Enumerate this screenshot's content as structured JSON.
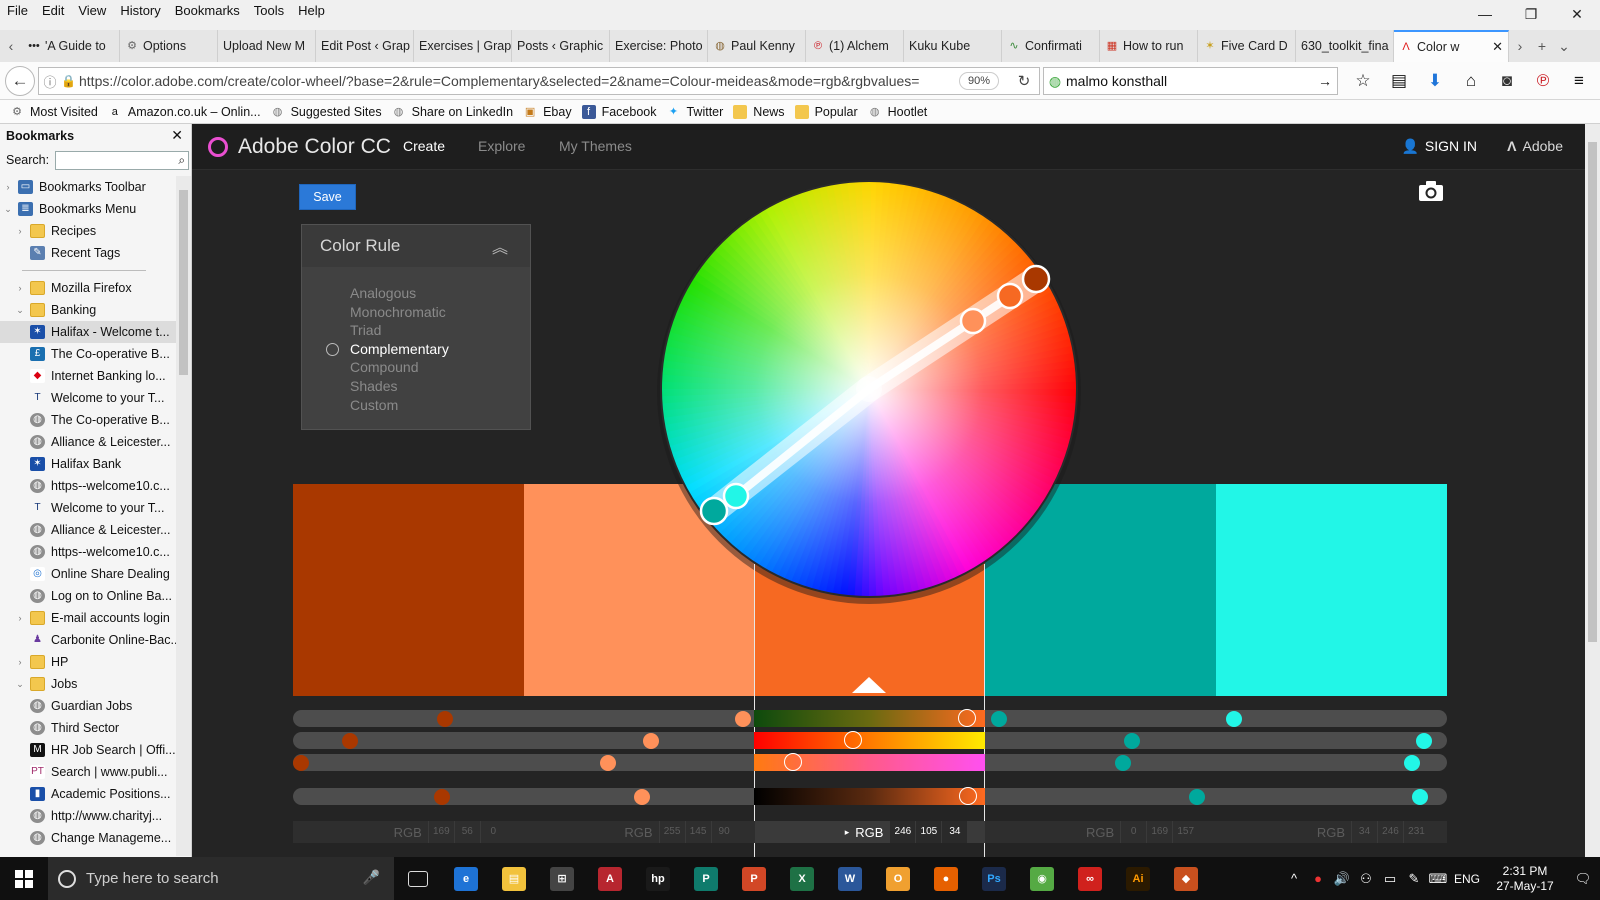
{
  "menubar": [
    "File",
    "Edit",
    "View",
    "History",
    "Bookmarks",
    "Tools",
    "Help"
  ],
  "tabs": [
    {
      "label": "'A Guide to",
      "icon": "dots-icon"
    },
    {
      "label": "Options",
      "icon": "gear-icon"
    },
    {
      "label": "Upload New M",
      "icon": "page-icon"
    },
    {
      "label": "Edit Post ‹ Grap",
      "icon": "page-icon"
    },
    {
      "label": "Exercises | Grap",
      "icon": "page-icon"
    },
    {
      "label": "Posts ‹ Graphic",
      "icon": "page-icon"
    },
    {
      "label": "Exercise: Photo",
      "icon": "page-icon"
    },
    {
      "label": "Paul Kenny",
      "icon": "avatar-icon"
    },
    {
      "label": "(1) Alchem",
      "icon": "pinterest-icon"
    },
    {
      "label": "Kuku Kube",
      "icon": "page-icon"
    },
    {
      "label": "Confirmati",
      "icon": "wave-icon"
    },
    {
      "label": "How to run",
      "icon": "grid-icon"
    },
    {
      "label": "Five Card D",
      "icon": "cards-icon"
    },
    {
      "label": "630_toolkit_fina",
      "icon": "page-icon"
    },
    {
      "label": "Color w",
      "icon": "adobe-icon",
      "active": true
    }
  ],
  "nav": {
    "url": "https://color.adobe.com/create/color-wheel/?base=2&rule=Complementary&selected=2&name=Colour-meideas&mode=rgb&rgbvalues=",
    "url_domain": "adobe.com",
    "zoom": "90%",
    "search_value": "malmo konsthall"
  },
  "bookmarks_toolbar": [
    {
      "label": "Most Visited",
      "icon": "gear-icon"
    },
    {
      "label": "Amazon.co.uk – Onlin...",
      "icon": "amazon-icon"
    },
    {
      "label": "Suggested Sites",
      "icon": "globe-icon"
    },
    {
      "label": "Share on LinkedIn",
      "icon": "globe-icon"
    },
    {
      "label": "Ebay",
      "icon": "bag-icon"
    },
    {
      "label": "Facebook",
      "icon": "facebook-icon"
    },
    {
      "label": "Twitter",
      "icon": "twitter-icon"
    },
    {
      "label": "News",
      "icon": "folder-icon"
    },
    {
      "label": "Popular",
      "icon": "folder-icon"
    },
    {
      "label": "Hootlet",
      "icon": "globe-icon"
    }
  ],
  "sidebar": {
    "title": "Bookmarks",
    "search_label": "Search:",
    "items": [
      {
        "label": "Bookmarks Toolbar",
        "level": 0,
        "twisty": "▷",
        "icon": "toolbar-icon"
      },
      {
        "label": "Bookmarks Menu",
        "level": 0,
        "twisty": "◢",
        "icon": "menu-icon"
      },
      {
        "label": "Recipes",
        "level": 1,
        "twisty": "▷",
        "icon": "folder-icon"
      },
      {
        "label": "Recent Tags",
        "level": 1,
        "twisty": "",
        "icon": "tag-icon"
      },
      {
        "sep": true
      },
      {
        "label": "Mozilla Firefox",
        "level": 1,
        "twisty": "▷",
        "icon": "folder-icon"
      },
      {
        "label": "Banking",
        "level": 1,
        "twisty": "◢",
        "icon": "folder-icon"
      },
      {
        "label": "Halifax - Welcome t...",
        "level": 2,
        "twisty": "",
        "icon": "halifax-icon",
        "selected": true
      },
      {
        "label": "The Co-operative B...",
        "level": 2,
        "twisty": "",
        "icon": "pound-icon"
      },
      {
        "label": "Internet Banking lo...",
        "level": 2,
        "twisty": "",
        "icon": "hsbc-icon"
      },
      {
        "label": "Welcome to your T...",
        "level": 2,
        "twisty": "",
        "icon": "t-icon"
      },
      {
        "label": "The Co-operative B...",
        "level": 2,
        "twisty": "",
        "icon": "globe-icon"
      },
      {
        "label": "Alliance & Leicester...",
        "level": 2,
        "twisty": "",
        "icon": "globe-icon"
      },
      {
        "label": "Halifax Bank",
        "level": 2,
        "twisty": "",
        "icon": "halifax-icon"
      },
      {
        "label": "https--welcome10.c...",
        "level": 2,
        "twisty": "",
        "icon": "globe-icon"
      },
      {
        "label": "Welcome to your T...",
        "level": 2,
        "twisty": "",
        "icon": "t-icon"
      },
      {
        "label": "Alliance & Leicester...",
        "level": 2,
        "twisty": "",
        "icon": "globe-icon"
      },
      {
        "label": "https--welcome10.c...",
        "level": 2,
        "twisty": "",
        "icon": "globe-icon"
      },
      {
        "label": "Online Share Dealing",
        "level": 2,
        "twisty": "",
        "icon": "share-icon"
      },
      {
        "label": "Log on to Online Ba...",
        "level": 2,
        "twisty": "",
        "icon": "globe-icon"
      },
      {
        "label": "E-mail accounts login",
        "level": 1,
        "twisty": "▷",
        "icon": "folder-icon"
      },
      {
        "label": "Carbonite Online-Bac...",
        "level": 1,
        "twisty": "",
        "icon": "carbonite-icon"
      },
      {
        "label": "HP",
        "level": 1,
        "twisty": "▷",
        "icon": "folder-icon"
      },
      {
        "label": "Jobs",
        "level": 1,
        "twisty": "◢",
        "icon": "folder-icon"
      },
      {
        "label": "Guardian Jobs",
        "level": 2,
        "twisty": "",
        "icon": "globe-icon"
      },
      {
        "label": "Third Sector",
        "level": 2,
        "twisty": "",
        "icon": "globe-icon"
      },
      {
        "label": "HR Job Search | Offi...",
        "level": 2,
        "twisty": "",
        "icon": "hr-icon"
      },
      {
        "label": "Search | www.publi...",
        "level": 2,
        "twisty": "",
        "icon": "pt-icon"
      },
      {
        "label": "Academic Positions...",
        "level": 2,
        "twisty": "",
        "icon": "academic-icon"
      },
      {
        "label": "http://www.charityj...",
        "level": 2,
        "twisty": "",
        "icon": "globe-icon"
      },
      {
        "label": "Change Manageme...",
        "level": 2,
        "twisty": "",
        "icon": "globe-icon"
      }
    ]
  },
  "app": {
    "brand": "Adobe Color CC",
    "nav": [
      "Create",
      "Explore",
      "My Themes"
    ],
    "active_nav": "Create",
    "sign_in": "SIGN IN",
    "adobe": "Adobe",
    "save_label": "Save"
  },
  "color_rule": {
    "title": "Color Rule",
    "options": [
      "Analogous",
      "Monochromatic",
      "Triad",
      "Complementary",
      "Compound",
      "Shades",
      "Custom"
    ],
    "selected": "Complementary"
  },
  "swatches": [
    {
      "hex": "#A93800",
      "rgb": [
        "169",
        "56",
        "0"
      ]
    },
    {
      "hex": "#FF915A",
      "rgb": [
        "255",
        "145",
        "90"
      ]
    },
    {
      "hex": "#F66922",
      "rgb": [
        "246",
        "105",
        "34"
      ],
      "base": true
    },
    {
      "hex": "#00A99D",
      "rgb": [
        "0",
        "169",
        "157"
      ]
    },
    {
      "hex": "#22F6E7",
      "rgb": [
        "34",
        "246",
        "231"
      ]
    }
  ],
  "rgb_label": "RGB",
  "taskbar": {
    "search_placeholder": "Type here to search",
    "apps": [
      {
        "icon": "task-view-icon",
        "color": "#101010",
        "text": "▭"
      },
      {
        "icon": "edge-icon",
        "color": "#1e73d6",
        "text": "e"
      },
      {
        "icon": "explorer-icon",
        "color": "#f2c23c",
        "text": "▤"
      },
      {
        "icon": "store-icon",
        "color": "#444444",
        "text": "⊞"
      },
      {
        "icon": "access-icon",
        "color": "#b7262f",
        "text": "A"
      },
      {
        "icon": "hp-icon",
        "color": "#1a1a1a",
        "text": "hp"
      },
      {
        "icon": "publisher-icon",
        "color": "#0f7b6c",
        "text": "P"
      },
      {
        "icon": "powerpoint-icon",
        "color": "#d24726",
        "text": "P"
      },
      {
        "icon": "excel-icon",
        "color": "#1e7145",
        "text": "X"
      },
      {
        "icon": "word-icon",
        "color": "#2b579a",
        "text": "W"
      },
      {
        "icon": "outlook-icon",
        "color": "#f0a030",
        "text": "O"
      },
      {
        "icon": "firefox-icon",
        "color": "#e66000",
        "text": "●"
      },
      {
        "icon": "photoshop-icon",
        "color": "#1b2a4a",
        "text": "Ps"
      },
      {
        "icon": "picasa-icon",
        "color": "#55aa44",
        "text": "◉"
      },
      {
        "icon": "creative-cloud-icon",
        "color": "#d0211d",
        "text": "∞"
      },
      {
        "icon": "illustrator-icon",
        "color": "#2b1a00",
        "text": "Ai"
      },
      {
        "icon": "app-icon",
        "color": "#c8501e",
        "text": "◆"
      }
    ],
    "lang": "ENG",
    "time": "2:31 PM",
    "date": "27-May-17"
  }
}
